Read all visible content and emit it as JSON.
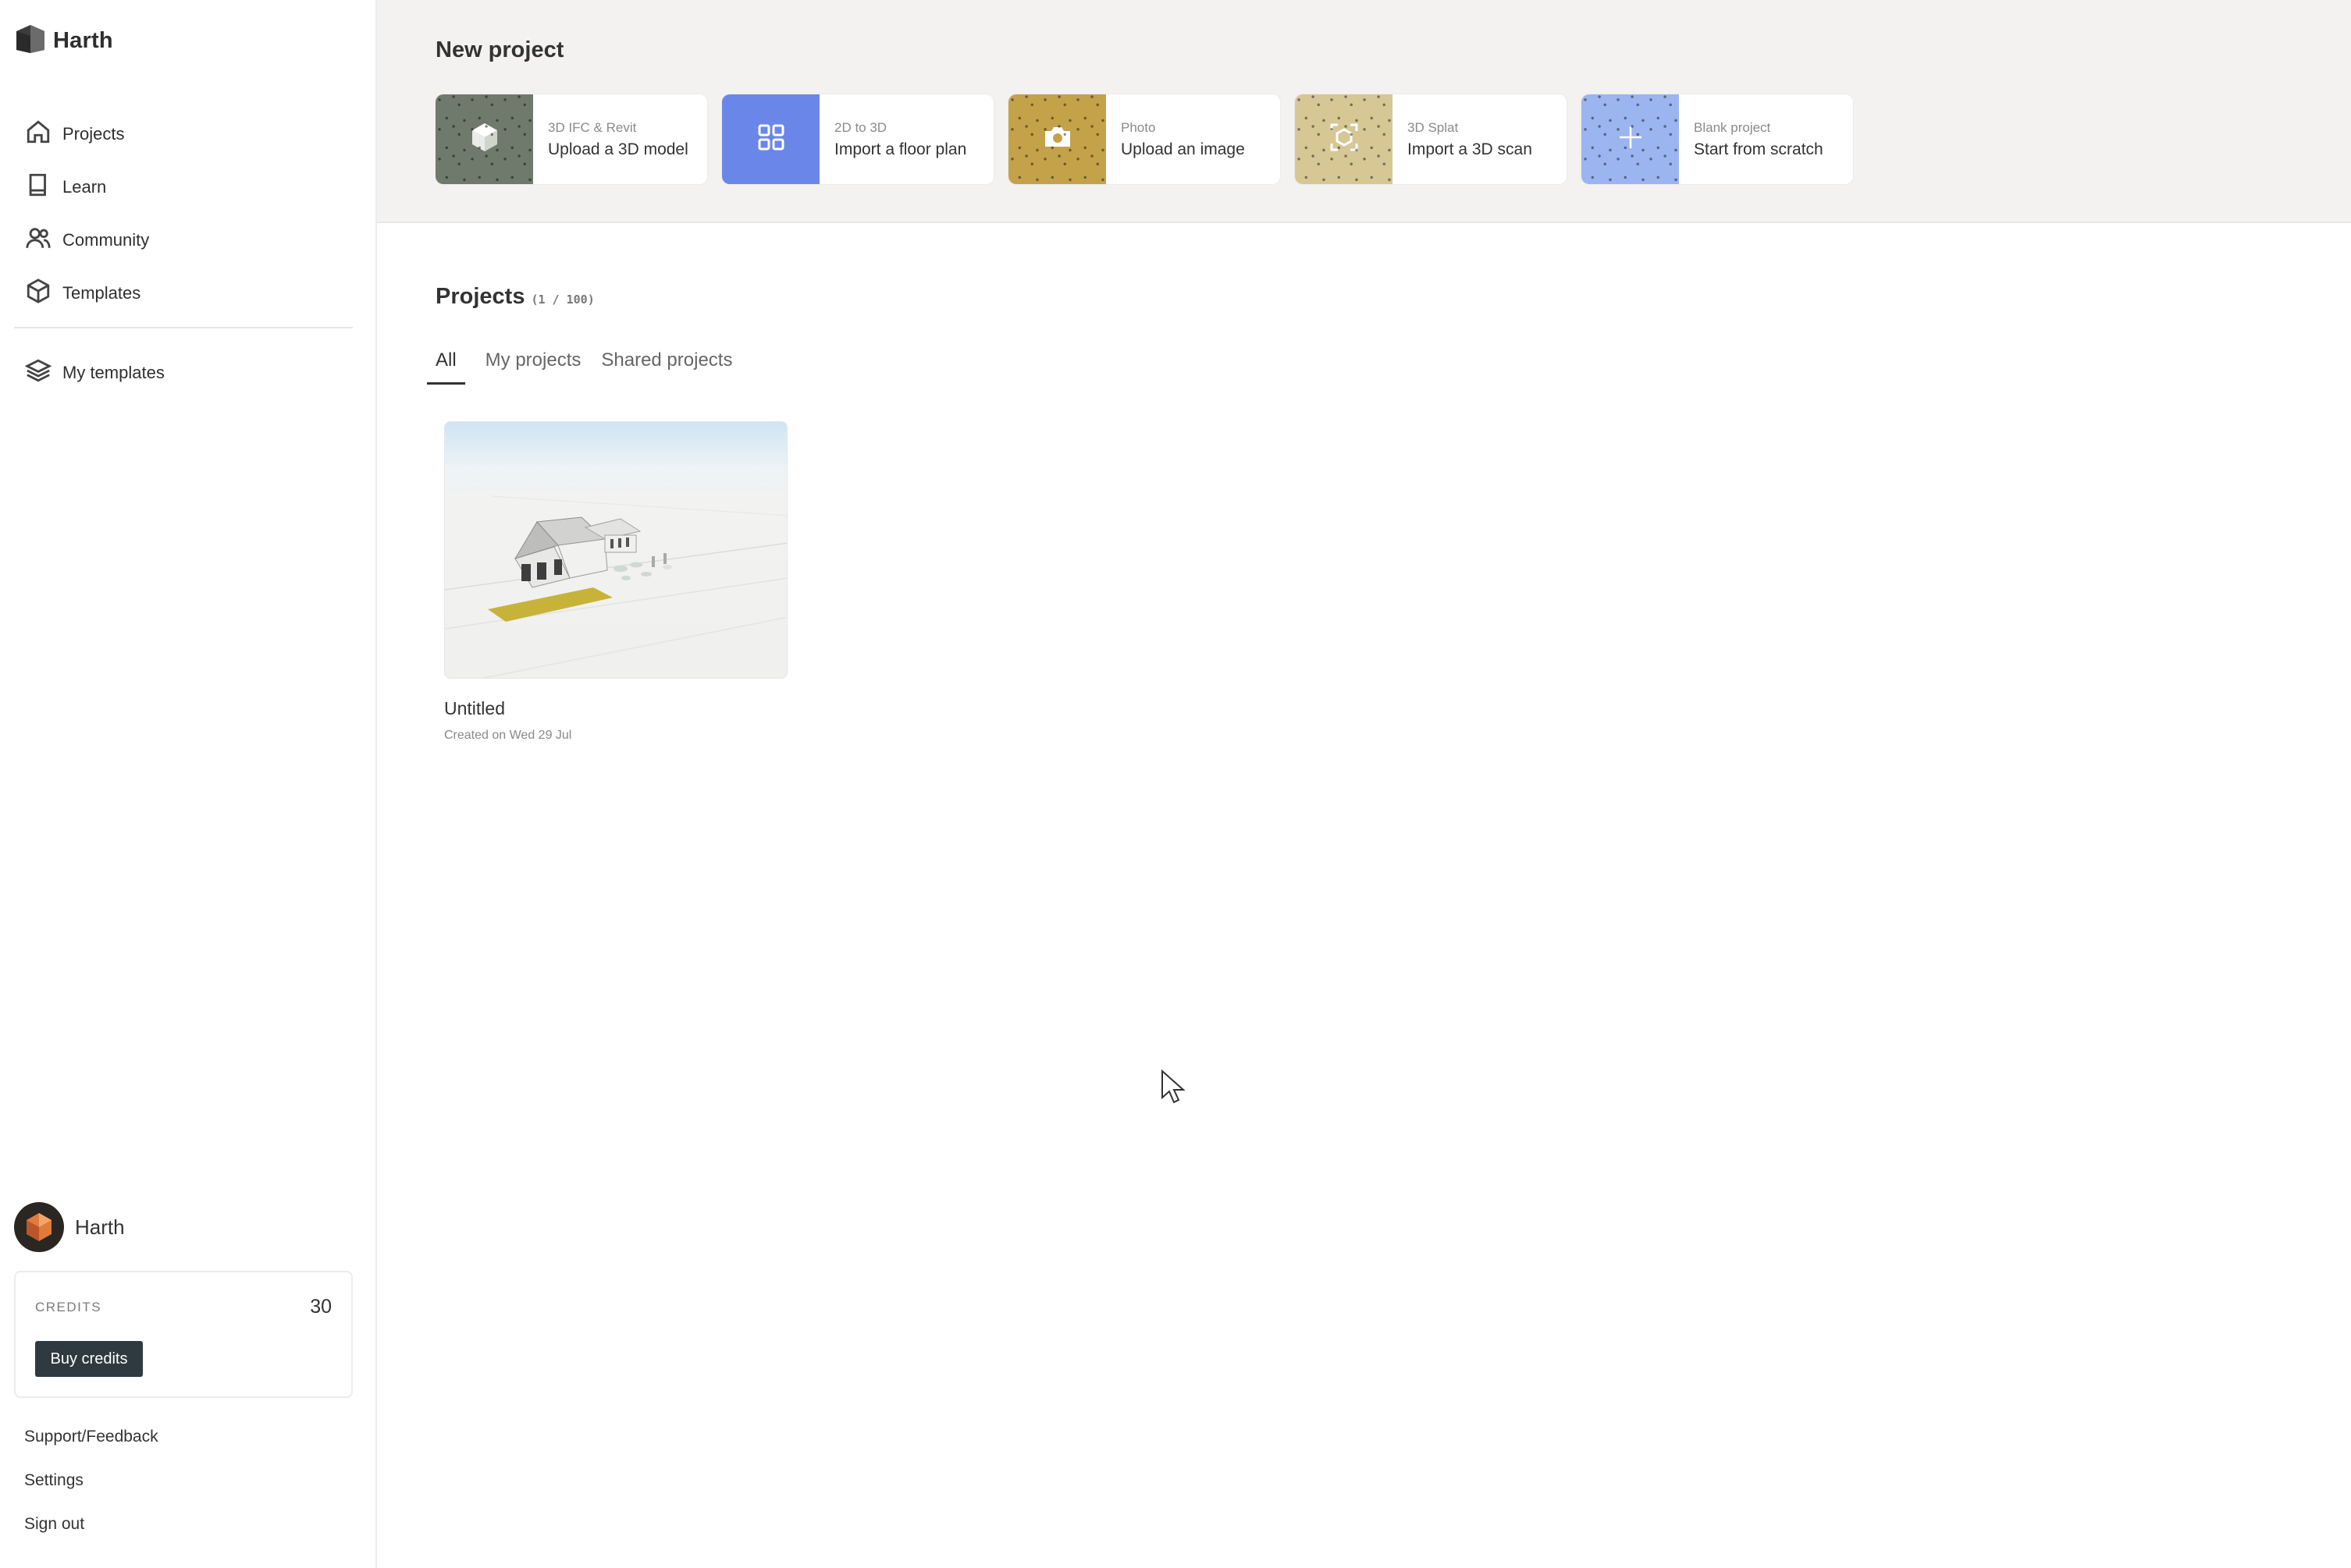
{
  "brand": {
    "name": "Harth"
  },
  "sidebar": {
    "nav": [
      {
        "label": "Projects",
        "icon": "home-icon"
      },
      {
        "label": "Learn",
        "icon": "book-icon"
      },
      {
        "label": "Community",
        "icon": "users-icon"
      },
      {
        "label": "Templates",
        "icon": "box-icon"
      }
    ],
    "nav_secondary": [
      {
        "label": "My templates",
        "icon": "layers-icon"
      }
    ],
    "user": {
      "name": "Harth"
    },
    "credits": {
      "label": "CREDITS",
      "value": "30",
      "buy_label": "Buy credits"
    },
    "footer": [
      "Support/Feedback",
      "Settings",
      "Sign out"
    ]
  },
  "new_project": {
    "title": "New project",
    "cards": [
      {
        "sub": "3D IFC & Revit",
        "main": "Upload a 3D model",
        "color": "#6f7a6c",
        "icon": "cube-icon"
      },
      {
        "sub": "2D to 3D",
        "main": "Import a floor plan",
        "color": "#6a86e8",
        "icon": "grid-icon"
      },
      {
        "sub": "Photo",
        "main": "Upload an image",
        "color": "#c4a24a",
        "icon": "camera-icon"
      },
      {
        "sub": "3D Splat",
        "main": "Import a 3D scan",
        "color": "#d6c794",
        "icon": "scan-icon"
      },
      {
        "sub": "Blank project",
        "main": "Start from scratch",
        "color": "#9bb5f0",
        "icon": "plus-icon"
      }
    ]
  },
  "projects": {
    "title": "Projects",
    "count": "(1 / 100)",
    "tabs": [
      "All",
      "My projects",
      "Shared projects"
    ],
    "active_tab": "All",
    "items": [
      {
        "name": "Untitled",
        "created": "Created on Wed 29 Jul"
      }
    ]
  }
}
